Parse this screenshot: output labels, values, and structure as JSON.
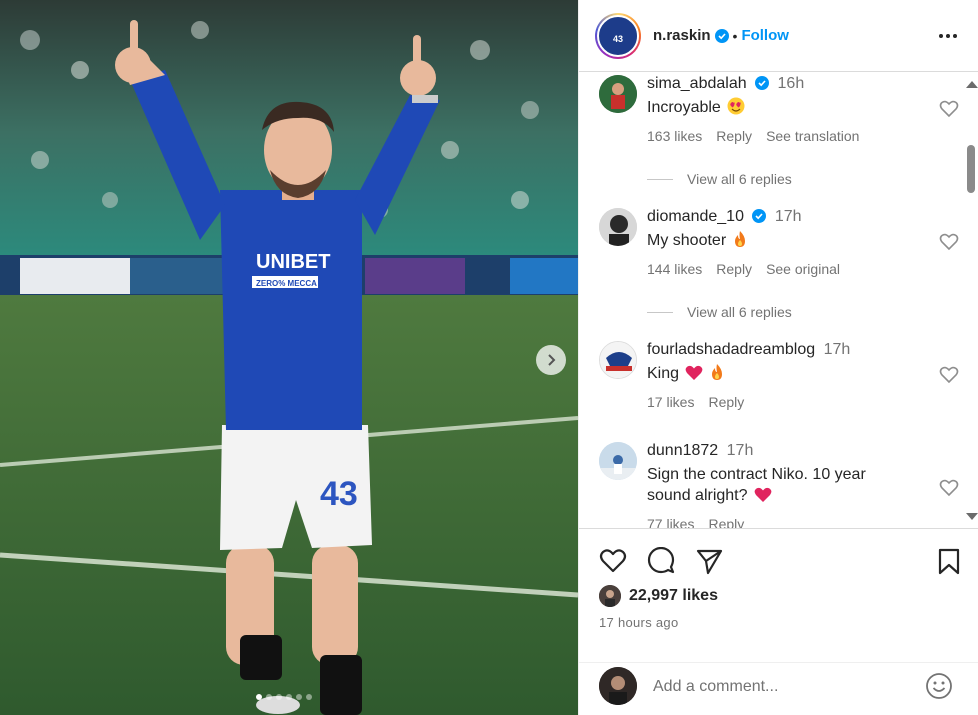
{
  "post": {
    "username": "n.raskin",
    "separator": "•",
    "follow_label": "Follow",
    "avatar_number": "43",
    "jersey_sponsor": "UNIBET",
    "jersey_sub": "ZERO% MECCA",
    "jersey_number": "43",
    "carousel": {
      "total": 6,
      "active": 1
    }
  },
  "comments": [
    {
      "user": "sima_abdalah",
      "verified": true,
      "time": "16h",
      "text": "Incroyable",
      "emoji": "heart-eyes",
      "likes": "163 likes",
      "reply": "Reply",
      "extra": "See translation",
      "replies": "View all 6 replies"
    },
    {
      "user": "diomande_10",
      "verified": true,
      "time": "17h",
      "text": "My shooter",
      "emoji": "fire",
      "likes": "144 likes",
      "reply": "Reply",
      "extra": "See original",
      "replies": "View all 6 replies"
    },
    {
      "user": "fourladshadadreamblog",
      "verified": false,
      "time": "17h",
      "text": "King",
      "emoji": "heart-fire",
      "likes": "17 likes",
      "reply": "Reply",
      "extra": ""
    },
    {
      "user": "dunn1872",
      "verified": false,
      "time": "17h",
      "text_line1": "Sign the contract Niko. 10 year",
      "text_line2": "sound alright?",
      "emoji": "heart",
      "likes": "77 likes",
      "reply": "Reply"
    }
  ],
  "actions": {
    "like_count": "22,997 likes",
    "posted": "17 hours ago",
    "add_comment_placeholder": "Add a comment..."
  },
  "colors": {
    "link": "#0095f6",
    "muted": "#737373",
    "text": "#262626",
    "jersey": "#1f49b6",
    "heart": "#ed4956"
  }
}
